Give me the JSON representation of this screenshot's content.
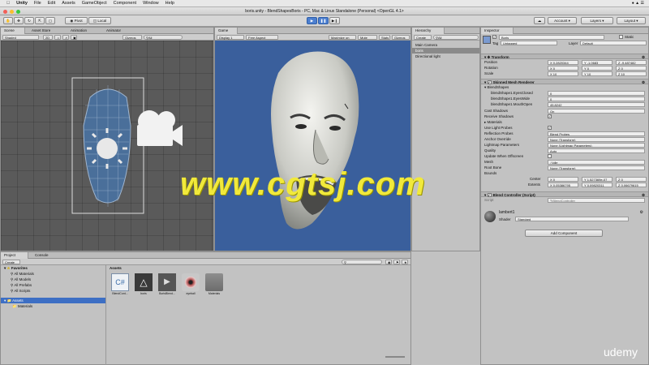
{
  "menubar": {
    "app": "Unity",
    "items": [
      "File",
      "Edit",
      "Assets",
      "GameObject",
      "Component",
      "Window",
      "Help"
    ]
  },
  "titlebar": {
    "title": "boris.unity - BlendShapesBoris - PC, Mac & Linux Standalone (Personal) <OpenGL 4.1>"
  },
  "toolbar": {
    "pivot": "Pivot",
    "local": "Local",
    "account": "Account",
    "layers": "Layers",
    "layout": "Layout"
  },
  "scene": {
    "tabs": [
      "Scene",
      "Asset Store",
      "Animation",
      "Animator"
    ],
    "shading": "Shaded",
    "mode": "2D",
    "gizmos": "Gizmos",
    "search": "All"
  },
  "game": {
    "tab": "Game",
    "display": "Display 1",
    "aspect": "Free Aspect",
    "buttons": [
      "Maximize on Play",
      "Mute audio",
      "Stats",
      "Gizmos"
    ]
  },
  "hierarchy": {
    "tab": "Hierarchy",
    "create": "Create",
    "search": "All",
    "items": [
      "Main Camera",
      "boris",
      "Directional light"
    ]
  },
  "inspector": {
    "tab": "Inspector",
    "object_name": "Boris",
    "static": "Static",
    "tag_label": "Tag",
    "tag": "Untagged",
    "layer_label": "Layer",
    "layer": "Default",
    "transform": {
      "header": "Transform",
      "rows": [
        {
          "label": "Position",
          "x": "0.2820344",
          "y": "-1.0683",
          "z": "-9.487482"
        },
        {
          "label": "Rotation",
          "x": "0",
          "y": "0",
          "z": "0"
        },
        {
          "label": "Scale",
          "x": "10",
          "y": "10",
          "z": "10"
        }
      ]
    },
    "smr": {
      "header": "Skinned Mesh Renderer",
      "blendshapes": "BlendShapes",
      "shapes": [
        {
          "label": "blendShape1.EyesClosed",
          "value": "0"
        },
        {
          "label": "blendShape1.EyesWide",
          "value": "0"
        },
        {
          "label": "blendShape1.MouthOpen",
          "value": "45.8242"
        }
      ],
      "props": [
        {
          "label": "Cast Shadows",
          "value": "On"
        },
        {
          "label": "Receive Shadows",
          "value": ""
        },
        {
          "label": "Materials",
          "value": ""
        },
        {
          "label": "Use Light Probes",
          "value": ""
        },
        {
          "label": "Reflection Probes",
          "value": "Blend Probes"
        },
        {
          "label": "Anchor Override",
          "value": "None (Transform)"
        },
        {
          "label": "Lightmap Parameters",
          "value": "None (Lightmap Parameters)"
        },
        {
          "label": "Quality",
          "value": "Auto"
        },
        {
          "label": "Update When Offscreen",
          "value": ""
        },
        {
          "label": "Mesh",
          "value": "Idle"
        },
        {
          "label": "Root Bone",
          "value": "None (Transform)"
        },
        {
          "label": "Bounds",
          "value": ""
        }
      ],
      "center_label": "Center",
      "center": {
        "x": "0",
        "y": "1.527369e-07",
        "z": "0"
      },
      "extents_label": "Extents",
      "extents": {
        "x": "0.05386795",
        "y": "0.09820311",
        "z": "0.06679615"
      }
    },
    "blend_controller": {
      "header": "Blend Controller (Script)",
      "script_label": "Script",
      "script": "BlendController"
    },
    "material": {
      "name": "lambert1",
      "shader_label": "Shader",
      "shader": "Standard"
    },
    "add_component": "Add Component"
  },
  "project": {
    "tabs": [
      "Project",
      "Console"
    ],
    "create": "Create",
    "favorites_header": "Favorites",
    "favorites": [
      "All Materials",
      "All Models",
      "All Prefabs",
      "All Scripts"
    ],
    "assets_header": "Assets",
    "folders": [
      "Materials"
    ],
    "breadcrumb": "Assets",
    "assets": [
      "BlendCont...",
      "boris",
      "BorisBlend...",
      "eyeball",
      "Materials"
    ]
  },
  "watermark": "www.cgtsj.com",
  "brand": "udemy",
  "colors": {
    "game_bg": "#3a5f9c",
    "scene_bg": "#5a5a5a",
    "watermark": "#f1e93b",
    "selection": "#3d6fc4"
  }
}
